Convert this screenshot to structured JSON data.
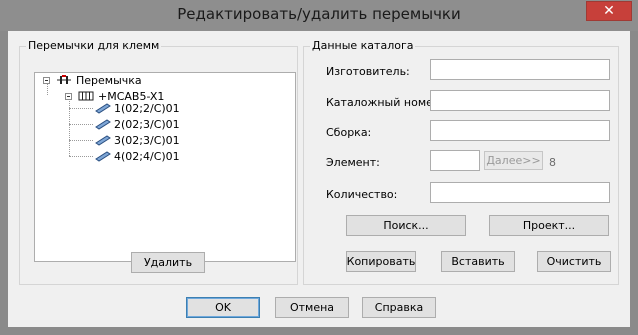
{
  "window": {
    "title": "Редактировать/удалить перемычки",
    "close_symbol": "✕"
  },
  "left_group": {
    "label": "Перемычки для клемм",
    "tree": {
      "root": "Перемычка",
      "child": "+MCAB5-X1",
      "leaves": [
        "1(02;2/C)01",
        "2(02;3/C)01",
        "3(02;3/C)01",
        "4(02;4/C)01"
      ]
    },
    "delete_button": "Удалить"
  },
  "right_group": {
    "label": "Данные каталога",
    "fields": {
      "manufacturer": {
        "label": "Изготовитель:",
        "value": ""
      },
      "catalog_number": {
        "label": "Каталожный номер:",
        "value": ""
      },
      "assembly": {
        "label": "Сборка:",
        "value": ""
      },
      "element": {
        "label": "Элемент:",
        "value": "",
        "next_button": "Далее>>",
        "count": "8"
      },
      "quantity": {
        "label": "Количество:",
        "value": ""
      }
    },
    "search_button": "Поиск...",
    "project_button": "Проект...",
    "copy_button": "Копировать",
    "paste_button": "Вставить",
    "clear_button": "Очистить"
  },
  "footer": {
    "ok_button": "OK",
    "cancel_button": "Отмена",
    "help_button": "Справка"
  }
}
